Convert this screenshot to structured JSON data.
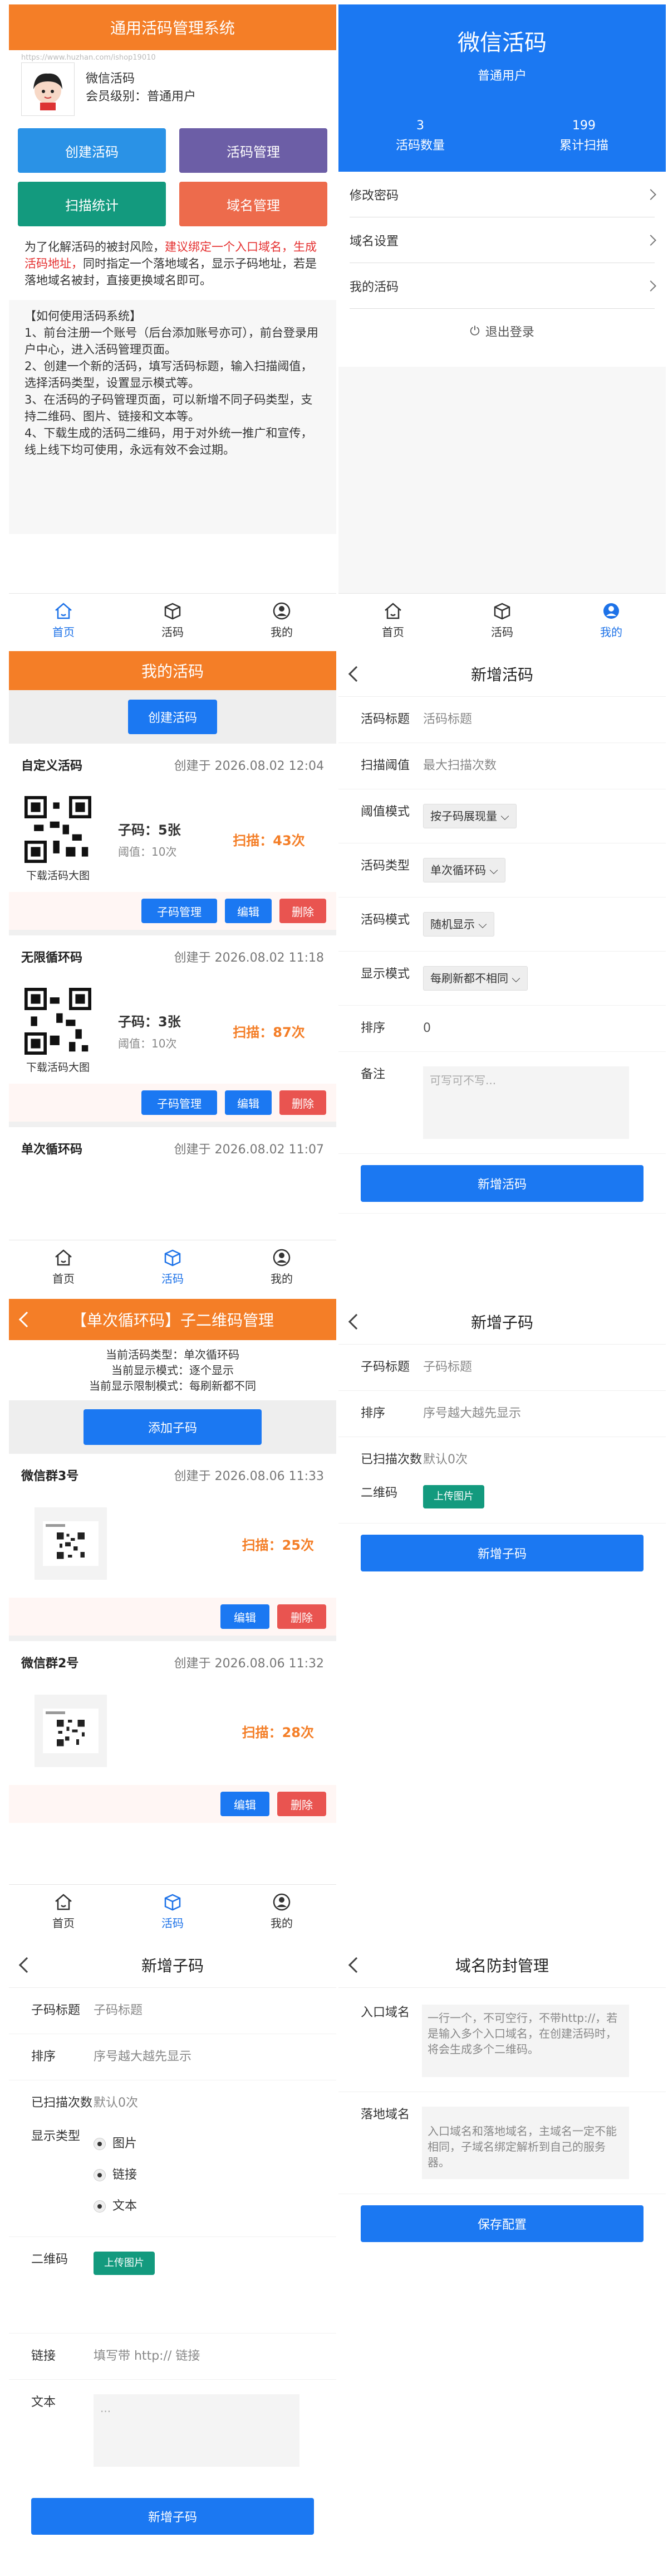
{
  "home": {
    "header": "通用活码管理系统",
    "watermark": "https://www.huzhan.com/ishop19010",
    "site_name": "微信活码",
    "level": "会员级别：普通用户",
    "buttons": [
      "创建活码",
      "活码管理",
      "扫描统计",
      "域名管理"
    ],
    "notice_prefix": "为了化解活码的被封风险，",
    "notice_red": "建议绑定一个入口域名，生成活码地址，",
    "notice_rest": "同时指定一个落地域名，显示子码地址，若是落地域名被封，直接更换域名即可。",
    "howto_title": "【如何使用活码系统】",
    "howto": [
      "1、前台注册一个账号（后台添加账号亦可），前台登录用户中心，进入活码管理页面。",
      "2、创建一个新的活码，填写活码标题，输入扫描阈值，选择活码类型，设置显示模式等。",
      "3、在活码的子码管理页面，可以新增不同子码类型，支持二维码、图片、链接和文本等。",
      "4、下载生成的活码二维码，用于对外统一推广和宣传，线上线下均可使用，永远有效不会过期。"
    ]
  },
  "tabs": {
    "home": "首页",
    "codes": "活码",
    "mine": "我的"
  },
  "profile": {
    "title": "微信活码",
    "role": "普通用户",
    "stats": [
      {
        "value": "3",
        "label": "活码数量"
      },
      {
        "value": "199",
        "label": "累计扫描"
      }
    ],
    "menu": [
      "修改密码",
      "域名设置",
      "我的活码"
    ],
    "logout": "退出登录"
  },
  "mycodes": {
    "header": "我的活码",
    "create": "创建活码",
    "cards": [
      {
        "name": "自定义活码",
        "created": "创建于 2026.08.02 12:04",
        "sub": "子码：5张",
        "threshold": "阈值：10次",
        "scans": "扫描：43次",
        "download": "下载活码大图"
      },
      {
        "name": "无限循环码",
        "created": "创建于 2026.08.02 11:18",
        "sub": "子码：3张",
        "threshold": "阈值：10次",
        "scans": "扫描：87次",
        "download": "下载活码大图"
      },
      {
        "name": "单次循环码",
        "created": "创建于 2026.08.02 11:07"
      }
    ],
    "actions": [
      "子码管理",
      "编辑",
      "删除"
    ]
  },
  "newcode": {
    "title": "新增活码",
    "fields": [
      {
        "label": "活码标题",
        "value": "活码标题"
      },
      {
        "label": "扫描阈值",
        "value": "最大扫描次数"
      },
      {
        "label": "阈值模式",
        "value": "按子码展现量"
      },
      {
        "label": "活码类型",
        "value": "单次循环码"
      },
      {
        "label": "活码模式",
        "value": "随机显示"
      },
      {
        "label": "显示模式",
        "value": "每刷新都不相同"
      },
      {
        "label": "排序",
        "value": "0"
      },
      {
        "label": "备注",
        "value": "可写可不写..."
      }
    ],
    "submit": "新增活码"
  },
  "subcodes": {
    "header": "【单次循环码】子二维码管理",
    "info": [
      "当前活码类型：单次循环码",
      "当前显示模式：逐个显示",
      "当前显示限制模式：每刷新都不同"
    ],
    "add": "添加子码",
    "cards": [
      {
        "name": "微信群3号",
        "created": "创建于 2026.08.06 11:33",
        "scans": "扫描：25次"
      },
      {
        "name": "微信群2号",
        "created": "创建于 2026.08.06 11:32",
        "scans": "扫描：28次"
      }
    ],
    "actions": [
      "编辑",
      "删除"
    ]
  },
  "newsub1": {
    "title": "新增子码",
    "fields": [
      {
        "label": "子码标题",
        "value": "子码标题"
      },
      {
        "label": "排序",
        "value": "序号越大越先显示"
      },
      {
        "label": "已扫描次数",
        "value": "默认0次"
      },
      {
        "label": "二维码",
        "value": "上传图片"
      }
    ],
    "submit": "新增子码"
  },
  "newsub2": {
    "title": "新增子码",
    "fields": [
      {
        "label": "子码标题",
        "value": "子码标题"
      },
      {
        "label": "排序",
        "value": "序号越大越先显示"
      },
      {
        "label": "已扫描次数",
        "value": "默认0次"
      }
    ],
    "display_label": "显示类型",
    "display_options": [
      "图片",
      "链接",
      "文本"
    ],
    "qr_label": "二维码",
    "upload": "上传图片",
    "link_label": "链接",
    "link_ph": "填写带 http:// 链接",
    "text_label": "文本",
    "text_ph": "...",
    "submit": "新增子码"
  },
  "domain": {
    "title": "域名防封管理",
    "entry_label": "入口域名",
    "entry_ph": "一行一个，不可空行，不带http://，若是输入多个入口域名，在创建活码时，将会生成多个二维码。",
    "land_label": "落地域名",
    "land_ph": "入口域名和落地域名，主域名一定不能相同，子域名绑定解析到自己的服务器。",
    "save": "保存配置"
  },
  "colors": {
    "orange": "#f47e27",
    "blue": "#1b78f2",
    "purple": "#6c5ea6",
    "teal": "#139a7e",
    "coral": "#ed6b4c",
    "red": "#e95450",
    "scan": "#f47e27"
  }
}
